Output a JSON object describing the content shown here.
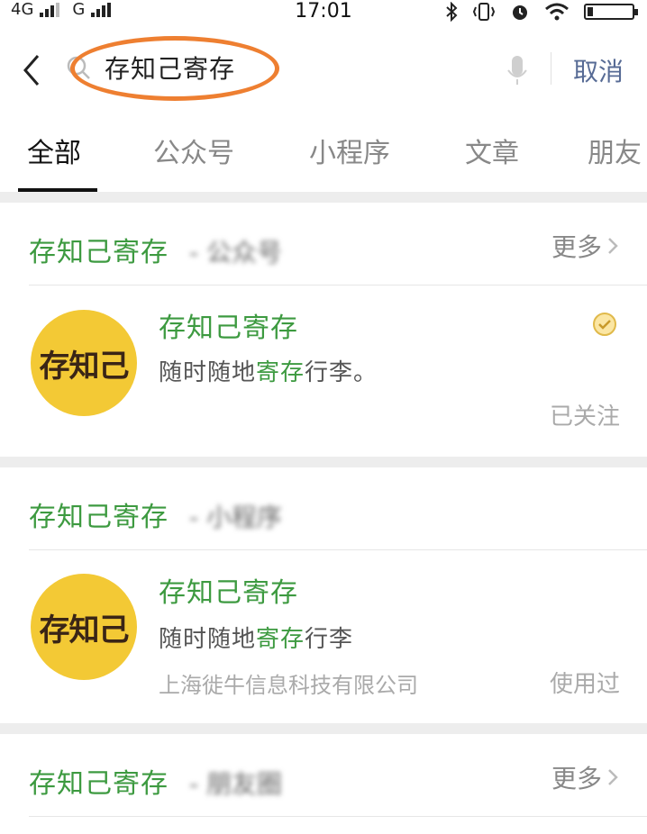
{
  "status": {
    "net1": "4G",
    "net2": "G",
    "time": "17:01"
  },
  "search": {
    "query": "存知己寄存",
    "cancel": "取消"
  },
  "tabs": [
    {
      "label": "全部",
      "active": true
    },
    {
      "label": "公众号"
    },
    {
      "label": "小程序"
    },
    {
      "label": "文章"
    },
    {
      "label": "朋友"
    }
  ],
  "sections": [
    {
      "title": "存知己寄存",
      "suffix": "- 公众号",
      "more": "更多",
      "item": {
        "avatar_text": "存知己",
        "name": "存知己寄存",
        "desc_pre": "随时随地",
        "desc_hl": "寄存",
        "desc_post": "行李。",
        "status": "已关注"
      }
    },
    {
      "title": "存知己寄存",
      "suffix": "- 小程序",
      "item": {
        "avatar_text": "存知己",
        "name": "存知己寄存",
        "desc_pre": "随时随地",
        "desc_hl": "寄存",
        "desc_post": "行李",
        "company": "上海徙牛信息科技有限公司",
        "status": "使用过"
      }
    },
    {
      "title": "存知己寄存",
      "suffix": "- 朋友圈",
      "more": "更多"
    }
  ],
  "colors": {
    "accent_green": "#3d9a40",
    "link_blue": "#576b95",
    "annotation_orange": "#ee7f31",
    "avatar_yellow": "#f3c935"
  }
}
